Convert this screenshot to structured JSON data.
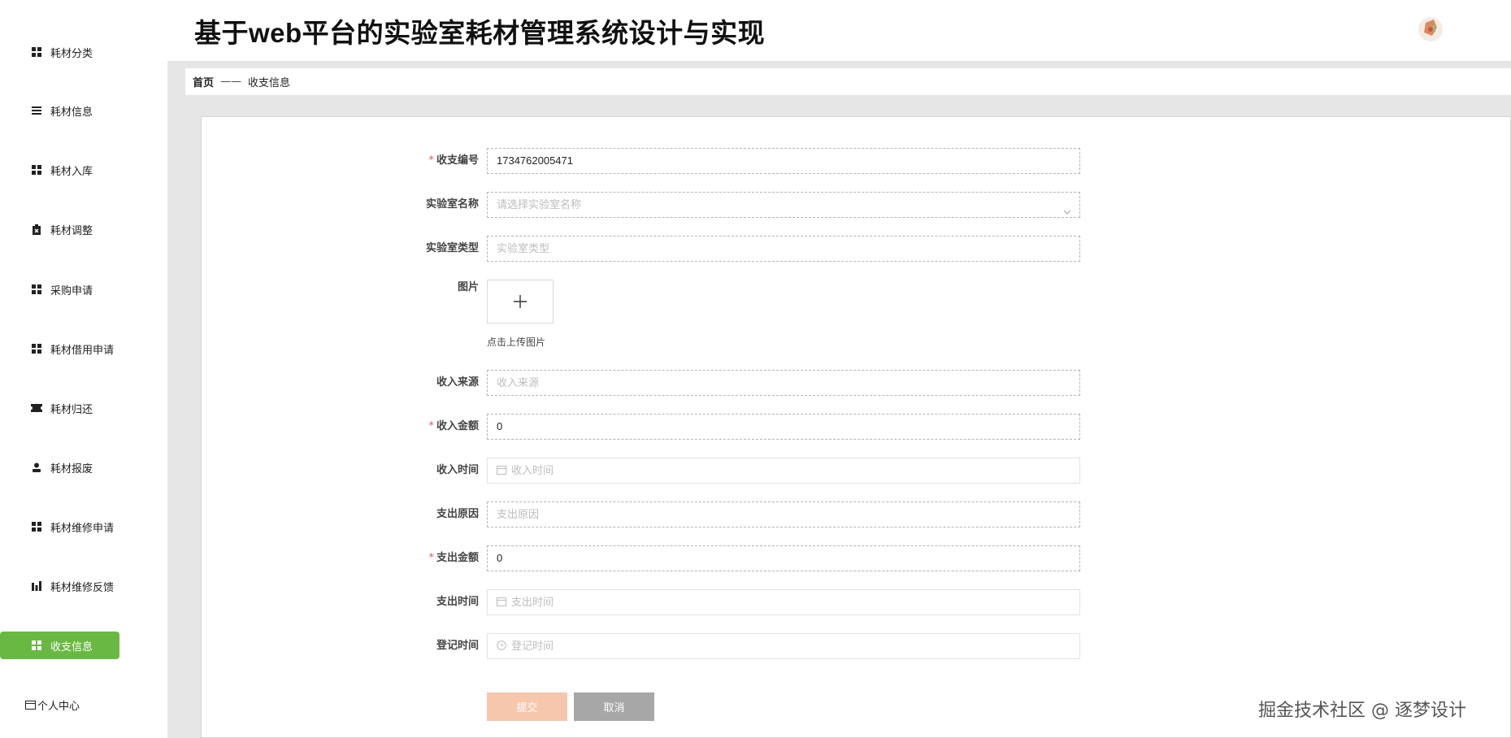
{
  "app": {
    "title": "基于web平台的实验室耗材管理系统设计与实现"
  },
  "sidebar": {
    "items": [
      {
        "label": "耗材分类",
        "icon": "grid-icon"
      },
      {
        "label": "耗材信息",
        "icon": "list-icon"
      },
      {
        "label": "耗材入库",
        "icon": "grid-icon"
      },
      {
        "label": "耗材调整",
        "icon": "clipboard-icon"
      },
      {
        "label": "采购申请",
        "icon": "grid-icon"
      },
      {
        "label": "耗材借用申请",
        "icon": "grid-icon"
      },
      {
        "label": "耗材归还",
        "icon": "ticket-icon"
      },
      {
        "label": "耗材报废",
        "icon": "user-icon"
      },
      {
        "label": "耗材维修申请",
        "icon": "grid-icon"
      },
      {
        "label": "耗材维修反馈",
        "icon": "bar-chart-icon"
      },
      {
        "label": "收支信息",
        "icon": "grid-icon",
        "active": true
      },
      {
        "label": "个人中心",
        "icon": "card-icon"
      }
    ]
  },
  "breadcrumb": {
    "home": "首页",
    "separator": "——",
    "current": "收支信息"
  },
  "form": {
    "number": {
      "label": "收支编号",
      "value": "1734762005471",
      "required": true
    },
    "lab_name": {
      "label": "实验室名称",
      "placeholder": "请选择实验室名称"
    },
    "lab_type": {
      "label": "实验室类型",
      "placeholder": "实验室类型"
    },
    "image": {
      "label": "图片",
      "hint": "点击上传图片"
    },
    "income_source": {
      "label": "收入来源",
      "placeholder": "收入来源"
    },
    "income_amount": {
      "label": "收入金额",
      "value": "0",
      "required": true
    },
    "income_time": {
      "label": "收入时间",
      "placeholder": "收入时间"
    },
    "expense_reason": {
      "label": "支出原因",
      "placeholder": "支出原因"
    },
    "expense_amount": {
      "label": "支出金额",
      "value": "0",
      "required": true
    },
    "expense_time": {
      "label": "支出时间",
      "placeholder": "支出时间"
    },
    "register_time": {
      "label": "登记时间",
      "placeholder": "登记时间"
    },
    "submit_label": "提交",
    "cancel_label": "取消"
  },
  "watermark": "掘金技术社区 @ 逐梦设计",
  "colors": {
    "active": "#6ab844",
    "submit": "#f6c7ad",
    "cancel": "#a7a7a7",
    "required": "#e05a5a"
  }
}
